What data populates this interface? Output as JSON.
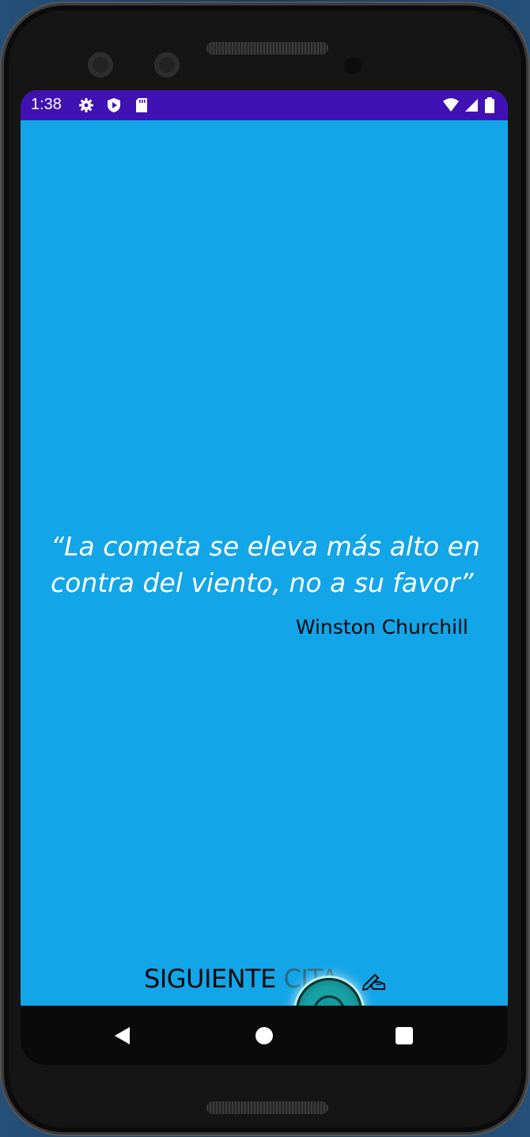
{
  "status_bar": {
    "time": "1:38",
    "left_icons": [
      "gear-icon",
      "shield-play-icon",
      "sd-card-icon"
    ],
    "right_icons": [
      "wifi-icon",
      "signal-icon",
      "battery-icon"
    ],
    "background_color": "#4012b3"
  },
  "quote_screen": {
    "quote": "“La cometa se eleva más alto en contra del viento, no a su favor”",
    "author": "Winston Churchill",
    "background_color": "#12a5e8"
  },
  "next_button": {
    "label_part1": "SIGUIENTE ",
    "label_part2": "CITA",
    "icon": "writing-hand-icon"
  },
  "nav_bar": {
    "buttons": [
      "back-icon",
      "home-icon",
      "recents-icon"
    ]
  }
}
